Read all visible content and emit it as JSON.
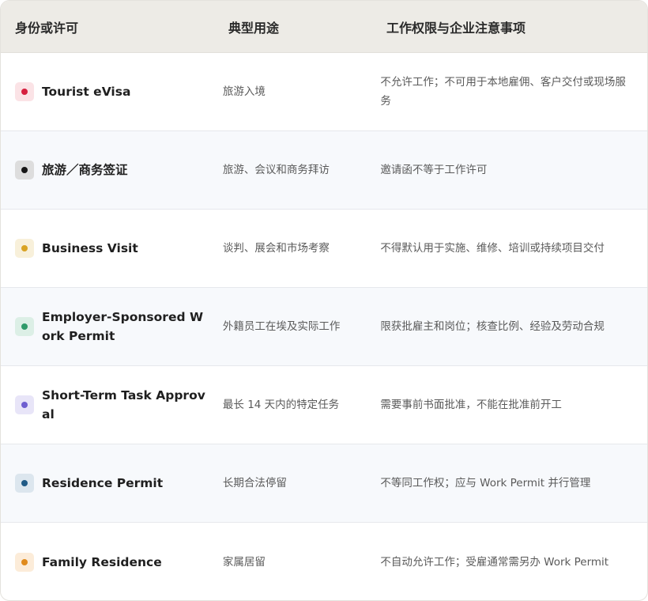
{
  "header": {
    "col1": "身份或许可",
    "col2": "典型用途",
    "col3": "工作权限与企业注意事项"
  },
  "rows": [
    {
      "name": "Tourist eVisa",
      "use": "旅游入境",
      "note": "不允许工作；不可用于本地雇佣、客户交付或现场服务",
      "dot_color": "#d6203f",
      "tint": "#fbe3e6"
    },
    {
      "name": "旅游／商务签证",
      "use": "旅游、会议和商务拜访",
      "note": "邀请函不等于工作许可",
      "dot_color": "#161616",
      "tint": "#dddddd"
    },
    {
      "name": "Business Visit",
      "use": "谈判、展会和市场考察",
      "note": "不得默认用于实施、维修、培训或持续项目交付",
      "dot_color": "#d9a323",
      "tint": "#f8f0da"
    },
    {
      "name": "Employer-Sponsored Work Permit",
      "use": "外籍员工在埃及实际工作",
      "note": "限获批雇主和岗位；核查比例、经验及劳动合规",
      "dot_color": "#2f9a6a",
      "tint": "#dcefe6"
    },
    {
      "name": "Short-Term Task Approval",
      "use": "最长 14 天内的特定任务",
      "note": "需要事前书面批准，不能在批准前开工",
      "dot_color": "#6f5fd0",
      "tint": "#e8e5f8"
    },
    {
      "name": "Residence Permit",
      "use": "长期合法停留",
      "note": "不等同工作权；应与 Work Permit 并行管理",
      "dot_color": "#1f5a86",
      "tint": "#dce6ee"
    },
    {
      "name": "Family Residence",
      "use": "家属居留",
      "note": "不自动允许工作；受雇通常需另办 Work Permit",
      "dot_color": "#e08a1c",
      "tint": "#fcecd9"
    }
  ]
}
